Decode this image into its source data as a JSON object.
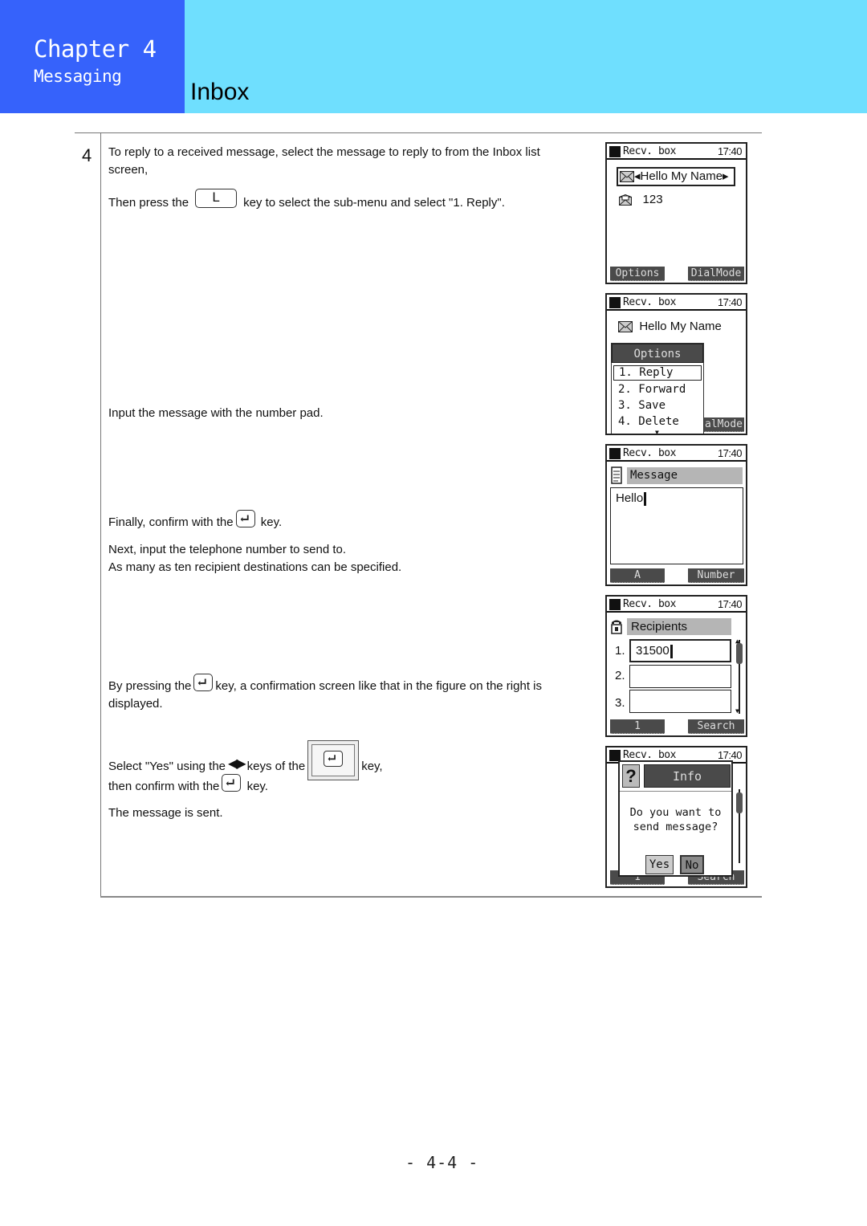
{
  "header": {
    "chapter": "Chapter 4",
    "chapter_subtitle": "Messaging",
    "page_title": "Inbox",
    "colors": {
      "chapter_bg": "#3662fb",
      "title_bg": "#6fdffe"
    }
  },
  "step": {
    "number": "4",
    "paragraphs": {
      "p1_line1": "To reply to a received message, select the message to reply to from the Inbox list",
      "p1_line2": "screen,",
      "p2_before": "Then press the",
      "p2_key": "L",
      "p2_after": "key to select the sub-menu and select \"1. Reply\".",
      "p3": "Input the message with the number pad.",
      "p4_before": "Finally, confirm with the",
      "p4_after": "key.",
      "p5_line1": "Next, input the telephone number to send to.",
      "p5_line2": "As many as ten recipient destinations can be specified.",
      "p6_before": "By pressing the",
      "p6_after": "key, a confirmation screen like that in the figure on the right is",
      "p6_line2": "displayed.",
      "p7_before": "Select \"Yes\" using the",
      "p7_arrows": "◀▶",
      "p7_middle": "keys of the",
      "p7_after": "key,",
      "p8_before": "then confirm with the",
      "p8_after": "key.",
      "p9": "The message is sent."
    }
  },
  "screens": [
    {
      "status_label": "Recv. box",
      "time": "17:40",
      "items": [
        {
          "icon": "envelope-icon",
          "text": "◂Hello My Name▸",
          "selected": true
        },
        {
          "icon": "envelope-open-icon",
          "text": "123",
          "selected": false
        }
      ],
      "softkeys": {
        "left": "Options",
        "right": "DialMode"
      }
    },
    {
      "status_label": "Recv. box",
      "time": "17:40",
      "item": "Hello My Name",
      "menu": {
        "title": "Options",
        "items": [
          "1. Reply",
          "2. Forward",
          "3. Save",
          "4. Delete"
        ],
        "selected_index": 0
      },
      "softkeys": {
        "right_partial": "alMode"
      }
    },
    {
      "status_label": "Recv. box",
      "time": "17:40",
      "header": "Message",
      "text": "Hello",
      "softkeys": {
        "left": "A",
        "right": "Number"
      }
    },
    {
      "status_label": "Recv. box",
      "time": "17:40",
      "header": "Recipients",
      "fields": [
        {
          "num": "1.",
          "value": "31500"
        },
        {
          "num": "2.",
          "value": ""
        },
        {
          "num": "3.",
          "value": ""
        }
      ],
      "softkeys": {
        "left": "1",
        "right": "Search"
      }
    },
    {
      "status_label": "Recv. box",
      "time": "17:40",
      "dialog": {
        "title": "Info",
        "line1": "Do you want to",
        "line2": "send message?",
        "yes": "Yes",
        "no": "No"
      },
      "softkeys": {
        "left": "1",
        "right": "Search"
      }
    }
  ],
  "footer": {
    "page_number": "- 4-4 -"
  }
}
